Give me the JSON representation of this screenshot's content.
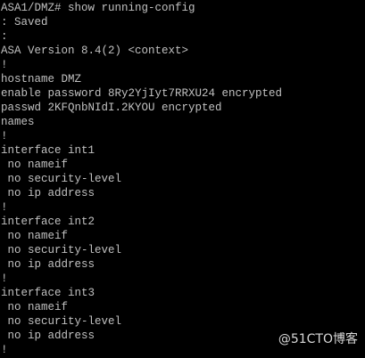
{
  "terminal": {
    "lines": [
      "ASA1/DMZ# show running-config",
      ": Saved",
      ":",
      "ASA Version 8.4(2) <context>",
      "!",
      "hostname DMZ",
      "enable password 8Ry2YjIyt7RRXU24 encrypted",
      "passwd 2KFQnbNIdI.2KYOU encrypted",
      "names",
      "!",
      "interface int1",
      " no nameif",
      " no security-level",
      " no ip address",
      "!",
      "interface int2",
      " no nameif",
      " no security-level",
      " no ip address",
      "!",
      "interface int3",
      " no nameif",
      " no security-level",
      " no ip address",
      "!"
    ]
  },
  "watermark": "@51CTO博客",
  "colors": {
    "background": "#000000",
    "text": "#c0c0c0"
  }
}
